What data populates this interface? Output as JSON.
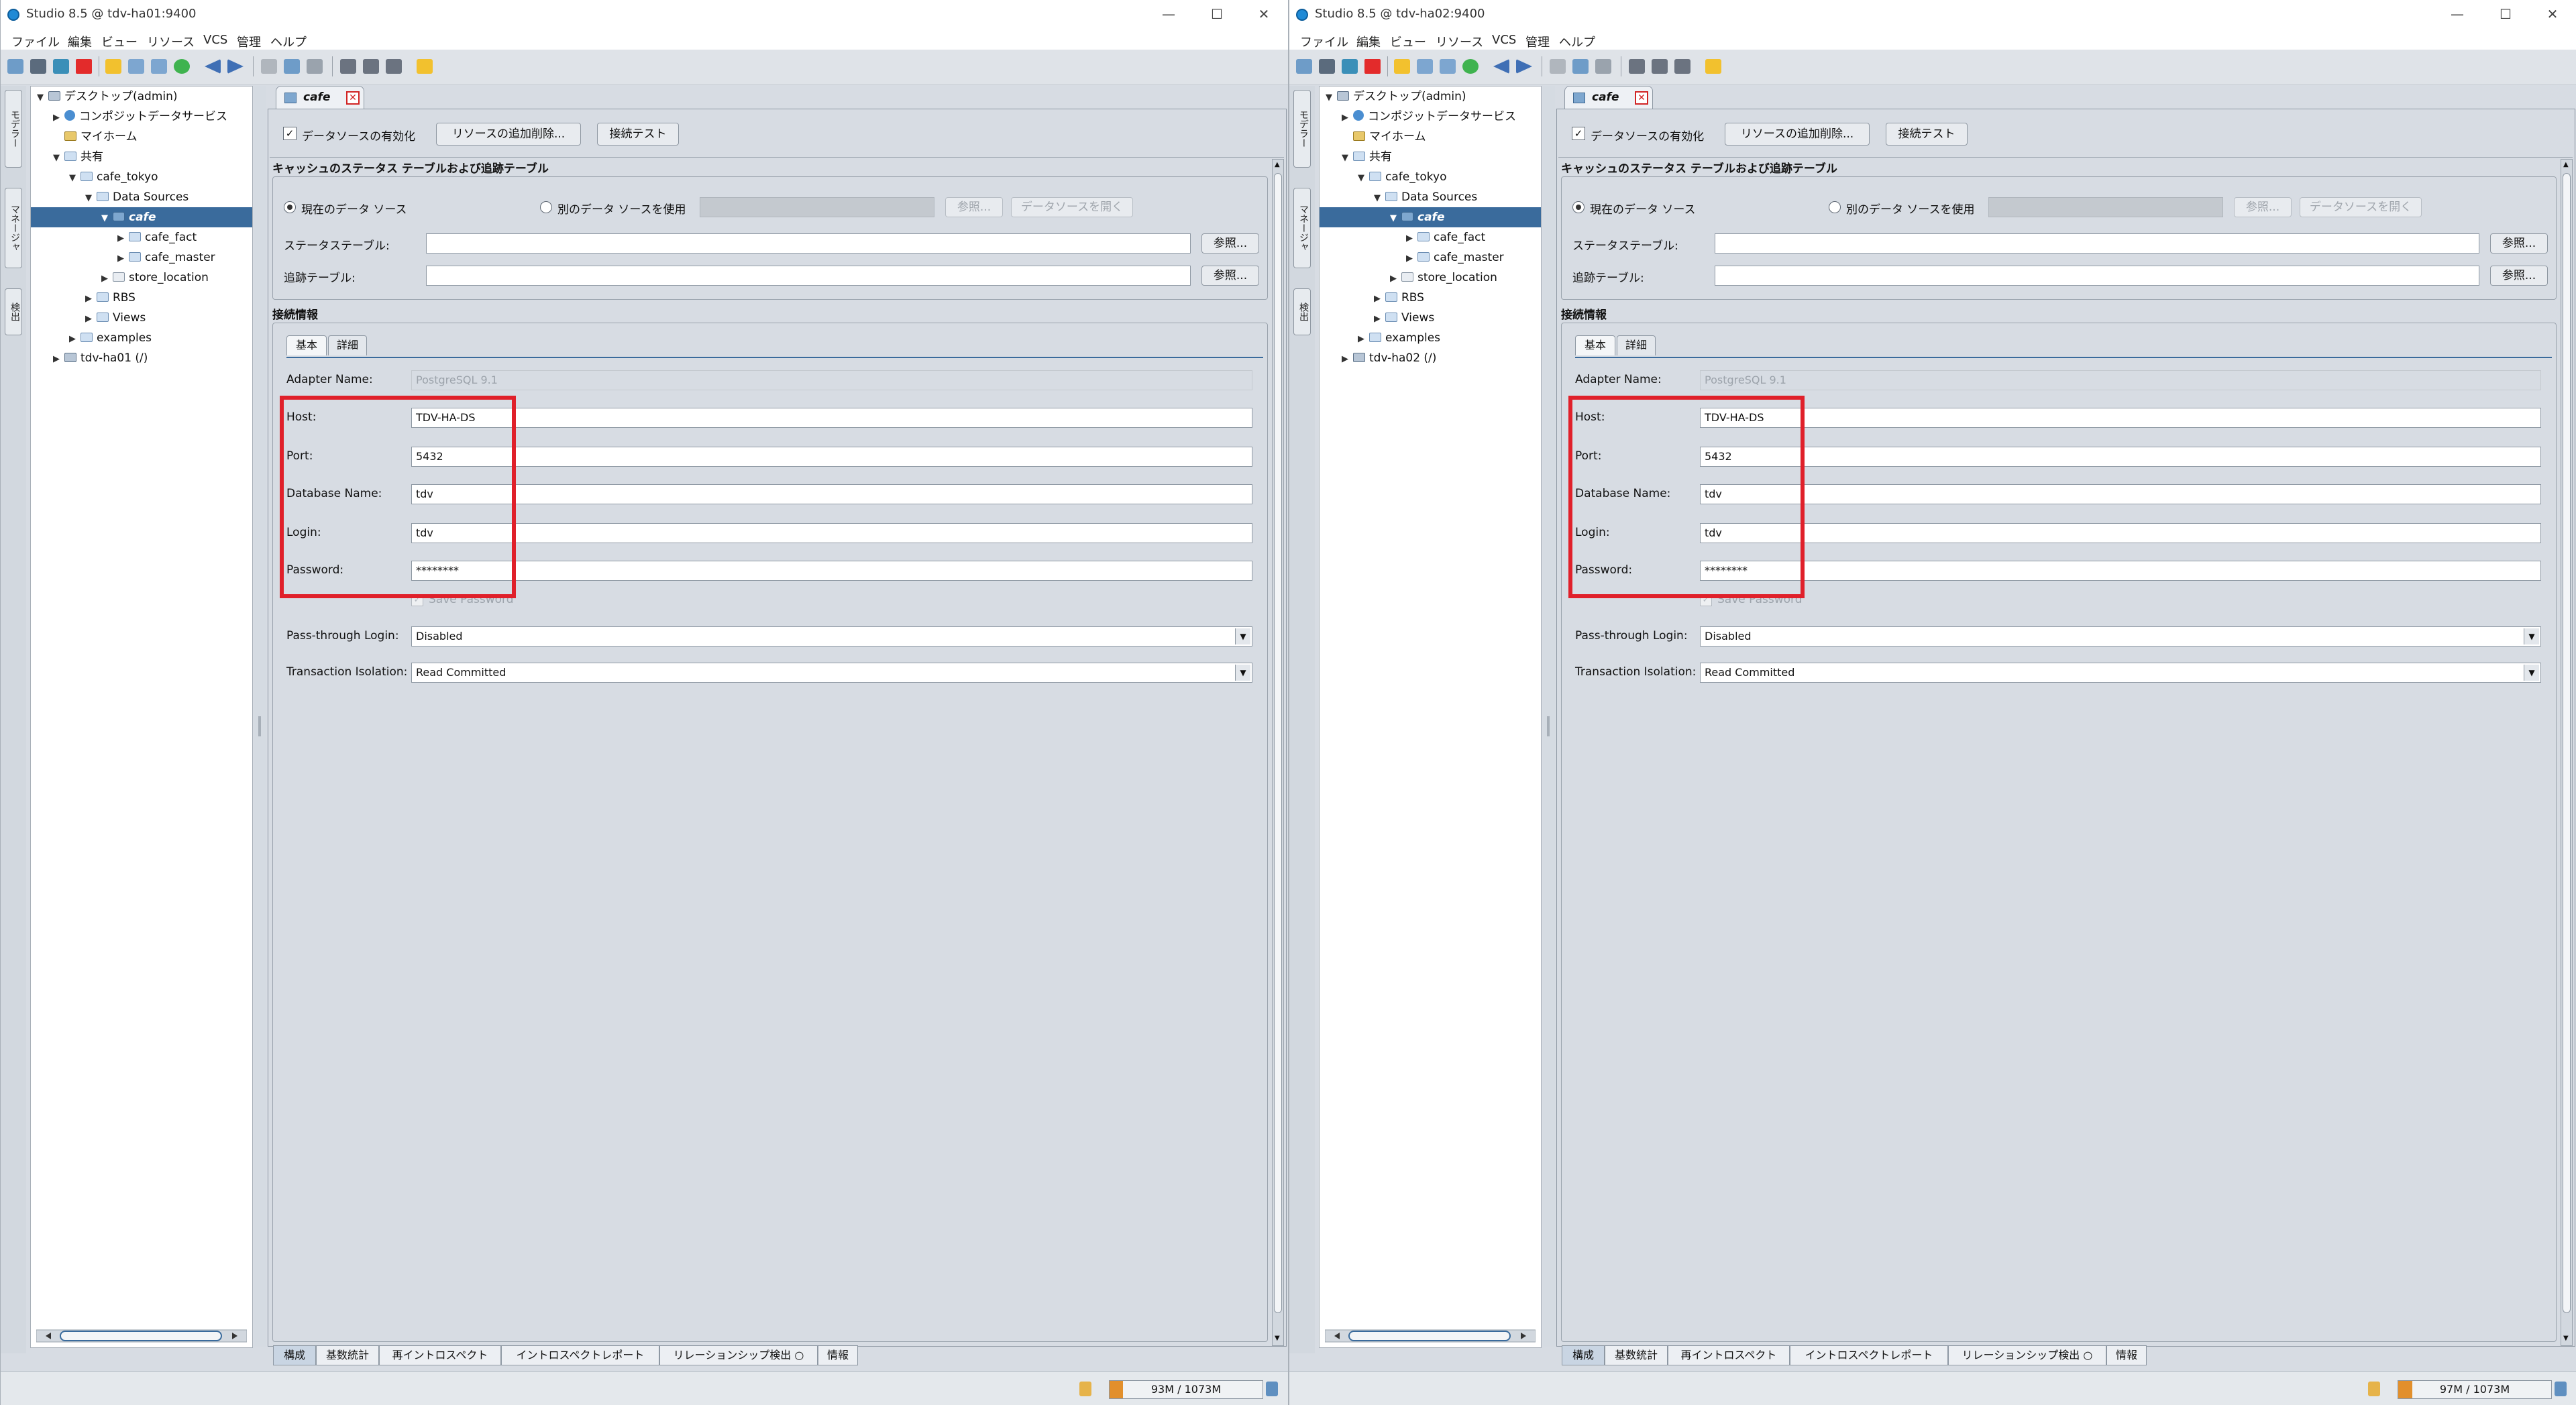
{
  "windows": [
    {
      "title": "Studio 8.5 @ tdv-ha01:9400",
      "menu": [
        "ファイル",
        "編集",
        "ビュー",
        "リソース",
        "VCS",
        "管理",
        "ヘルプ"
      ],
      "side_tabs": [
        "モデラー",
        "マネージャ",
        "検出"
      ],
      "tree": [
        {
          "label": "デスクトップ(admin)",
          "depth": 0,
          "toggle": "▼",
          "icon": "server"
        },
        {
          "label": "コンポジットデータサービス",
          "depth": 1,
          "toggle": "▶",
          "icon": "globe"
        },
        {
          "label": "マイホーム",
          "depth": 1,
          "toggle": "",
          "icon": "home"
        },
        {
          "label": "共有",
          "depth": 1,
          "toggle": "▼",
          "icon": "folder"
        },
        {
          "label": "cafe_tokyo",
          "depth": 2,
          "toggle": "▼",
          "icon": "folder"
        },
        {
          "label": "Data Sources",
          "depth": 3,
          "toggle": "▼",
          "icon": "folder"
        },
        {
          "label": "cafe",
          "depth": 4,
          "toggle": "▼",
          "icon": "db",
          "selected": true
        },
        {
          "label": "cafe_fact",
          "depth": 5,
          "toggle": "▶",
          "icon": "folder"
        },
        {
          "label": "cafe_master",
          "depth": 5,
          "toggle": "▶",
          "icon": "folder"
        },
        {
          "label": "store_location",
          "depth": 4,
          "toggle": "▶",
          "icon": "dbfile"
        },
        {
          "label": "RBS",
          "depth": 3,
          "toggle": "▶",
          "icon": "folder"
        },
        {
          "label": "Views",
          "depth": 3,
          "toggle": "▶",
          "icon": "folder"
        },
        {
          "label": "examples",
          "depth": 2,
          "toggle": "▶",
          "icon": "folder"
        },
        {
          "label": "tdv-ha01 (/)",
          "depth": 1,
          "toggle": "▶",
          "icon": "server"
        }
      ],
      "doc_tab": "cafe",
      "enable_datasource": "データソースの有効化",
      "delete_resources_button": "リソースの追加削除...",
      "test_connection_button": "接続テスト",
      "cache_section_title": "キャッシュのステータス テーブルおよび追跡テーブル",
      "radio_current": "現在のデータ ソース",
      "radio_other": "別のデータ ソースを使用",
      "browse_disabled": "参照...",
      "open_datasource_disabled": "データソースを開く",
      "status_table_label": "ステータステーブル:",
      "tracking_table_label": "追跡テーブル:",
      "browse_button": "参照...",
      "connection_section_title": "接続情報",
      "subtabs": [
        "基本",
        "詳細"
      ],
      "adapter_label": "Adapter Name:",
      "adapter_value": "PostgreSQL 9.1",
      "host_label": "Host:",
      "host_value": "TDV-HA-DS",
      "port_label": "Port:",
      "port_value": "5432",
      "dbname_label": "Database Name:",
      "dbname_value": "tdv",
      "login_label": "Login:",
      "login_value": "tdv",
      "password_label": "Password:",
      "password_value": "********",
      "save_password": "Save Password",
      "passthrough_label": "Pass-through Login:",
      "passthrough_value": "Disabled",
      "isolation_label": "Transaction Isolation:",
      "isolation_value": "Read Committed",
      "bottom_tabs": [
        "構成",
        "基数統計",
        "再イントロスペクト",
        "イントロスペクトレポート",
        "リレーションシップ検出 ○",
        "情報"
      ],
      "memory": "93M / 1073M",
      "memory_fraction": 0.087
    },
    {
      "title": "Studio 8.5 @ tdv-ha02:9400",
      "menu": [
        "ファイル",
        "編集",
        "ビュー",
        "リソース",
        "VCS",
        "管理",
        "ヘルプ"
      ],
      "side_tabs": [
        "モデラー",
        "マネージャ",
        "検出"
      ],
      "tree": [
        {
          "label": "デスクトップ(admin)",
          "depth": 0,
          "toggle": "▼",
          "icon": "server"
        },
        {
          "label": "コンポジットデータサービス",
          "depth": 1,
          "toggle": "▶",
          "icon": "globe"
        },
        {
          "label": "マイホーム",
          "depth": 1,
          "toggle": "",
          "icon": "home"
        },
        {
          "label": "共有",
          "depth": 1,
          "toggle": "▼",
          "icon": "folder"
        },
        {
          "label": "cafe_tokyo",
          "depth": 2,
          "toggle": "▼",
          "icon": "folder"
        },
        {
          "label": "Data Sources",
          "depth": 3,
          "toggle": "▼",
          "icon": "folder"
        },
        {
          "label": "cafe",
          "depth": 4,
          "toggle": "▼",
          "icon": "db",
          "selected": true
        },
        {
          "label": "cafe_fact",
          "depth": 5,
          "toggle": "▶",
          "icon": "folder"
        },
        {
          "label": "cafe_master",
          "depth": 5,
          "toggle": "▶",
          "icon": "folder"
        },
        {
          "label": "store_location",
          "depth": 4,
          "toggle": "▶",
          "icon": "dbfile"
        },
        {
          "label": "RBS",
          "depth": 3,
          "toggle": "▶",
          "icon": "folder"
        },
        {
          "label": "Views",
          "depth": 3,
          "toggle": "▶",
          "icon": "folder"
        },
        {
          "label": "examples",
          "depth": 2,
          "toggle": "▶",
          "icon": "folder"
        },
        {
          "label": "tdv-ha02 (/)",
          "depth": 1,
          "toggle": "▶",
          "icon": "server"
        }
      ],
      "doc_tab": "cafe",
      "enable_datasource": "データソースの有効化",
      "delete_resources_button": "リソースの追加削除...",
      "test_connection_button": "接続テスト",
      "cache_section_title": "キャッシュのステータス テーブルおよび追跡テーブル",
      "radio_current": "現在のデータ ソース",
      "radio_other": "別のデータ ソースを使用",
      "browse_disabled": "参照...",
      "open_datasource_disabled": "データソースを開く",
      "status_table_label": "ステータステーブル:",
      "tracking_table_label": "追跡テーブル:",
      "browse_button": "参照...",
      "connection_section_title": "接続情報",
      "subtabs": [
        "基本",
        "詳細"
      ],
      "adapter_label": "Adapter Name:",
      "adapter_value": "PostgreSQL 9.1",
      "host_label": "Host:",
      "host_value": "TDV-HA-DS",
      "port_label": "Port:",
      "port_value": "5432",
      "dbname_label": "Database Name:",
      "dbname_value": "tdv",
      "login_label": "Login:",
      "login_value": "tdv",
      "password_label": "Password:",
      "password_value": "********",
      "save_password": "Save Password",
      "passthrough_label": "Pass-through Login:",
      "passthrough_value": "Disabled",
      "isolation_label": "Transaction Isolation:",
      "isolation_value": "Read Committed",
      "bottom_tabs": [
        "構成",
        "基数統計",
        "再イントロスペクト",
        "イントロスペクトレポート",
        "リレーションシップ検出 ○",
        "情報"
      ],
      "memory": "97M / 1073M",
      "memory_fraction": 0.09
    }
  ],
  "colors": {
    "highlight": "#e0202a",
    "selection": "#3a6b9c",
    "panel_bg": "#d7dce3",
    "memory_bar": "#e28f2b"
  }
}
